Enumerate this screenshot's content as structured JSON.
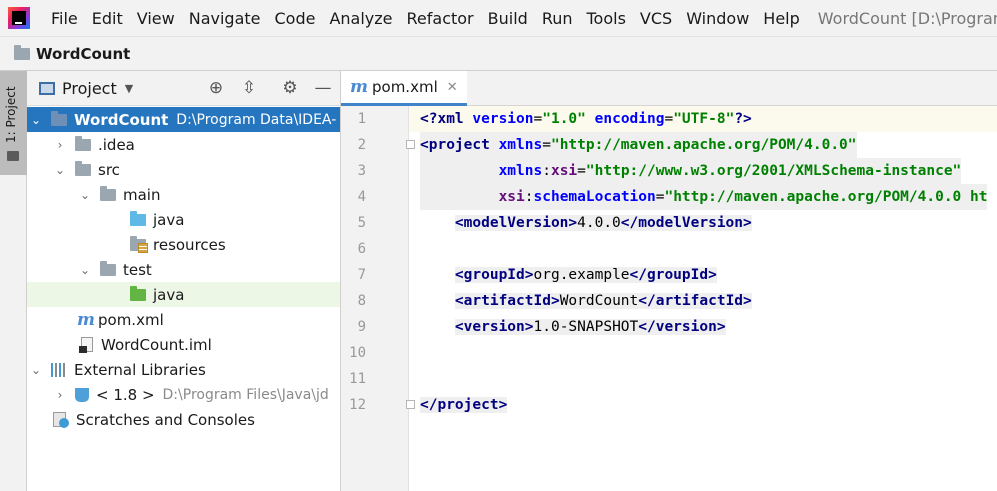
{
  "menubar": {
    "items": [
      "File",
      "Edit",
      "View",
      "Navigate",
      "Code",
      "Analyze",
      "Refactor",
      "Build",
      "Run",
      "Tools",
      "VCS",
      "Window",
      "Help"
    ],
    "window_title": "WordCount [D:\\Program Dat"
  },
  "navbar": {
    "project_name": "WordCount"
  },
  "toolstrip": {
    "label": "1: Project"
  },
  "project_panel": {
    "title": "Project",
    "tree": [
      {
        "label": "WordCount",
        "path": "D:\\Program Data\\IDEA-"
      },
      {
        "label": ".idea"
      },
      {
        "label": "src"
      },
      {
        "label": "main"
      },
      {
        "label": "java"
      },
      {
        "label": "resources"
      },
      {
        "label": "test"
      },
      {
        "label": "java"
      },
      {
        "label": "pom.xml"
      },
      {
        "label": "WordCount.iml"
      },
      {
        "label": "External Libraries"
      },
      {
        "label": "< 1.8 >",
        "path": "D:\\Program Files\\Java\\jd"
      },
      {
        "label": "Scratches and Consoles"
      }
    ]
  },
  "editor": {
    "tab": {
      "label": "pom.xml"
    },
    "line_numbers": [
      "1",
      "2",
      "3",
      "4",
      "5",
      "6",
      "7",
      "8",
      "9",
      "10",
      "11",
      "12"
    ],
    "code": {
      "l1": {
        "open": "<?xml",
        "a1": "version",
        "v1": "\"1.0\"",
        "a2": "encoding",
        "v2": "\"UTF-8\"",
        "close": "?>"
      },
      "l2": {
        "tag": "<project",
        "attr": "xmlns",
        "val": "\"http://maven.apache.org/POM/4.0.0\""
      },
      "l3": {
        "ns": "xmlns",
        "attr": "xsi",
        "val": "\"http://www.w3.org/2001/XMLSchema-instance\""
      },
      "l4": {
        "ns": "xsi",
        "attr": "schemaLocation",
        "val": "\"http://maven.apache.org/POM/4.0.0 ht"
      },
      "l5": {
        "open": "<modelVersion>",
        "text": "4.0.0",
        "close": "</modelVersion>"
      },
      "l7": {
        "open": "<groupId>",
        "text": "org.example",
        "close": "</groupId>"
      },
      "l8": {
        "open": "<artifactId>",
        "text": "WordCount",
        "close": "</artifactId>"
      },
      "l9": {
        "open": "<version>",
        "text": "1.0-SNAPSHOT",
        "close": "</version>"
      },
      "l12": {
        "close": "</project>"
      }
    }
  }
}
